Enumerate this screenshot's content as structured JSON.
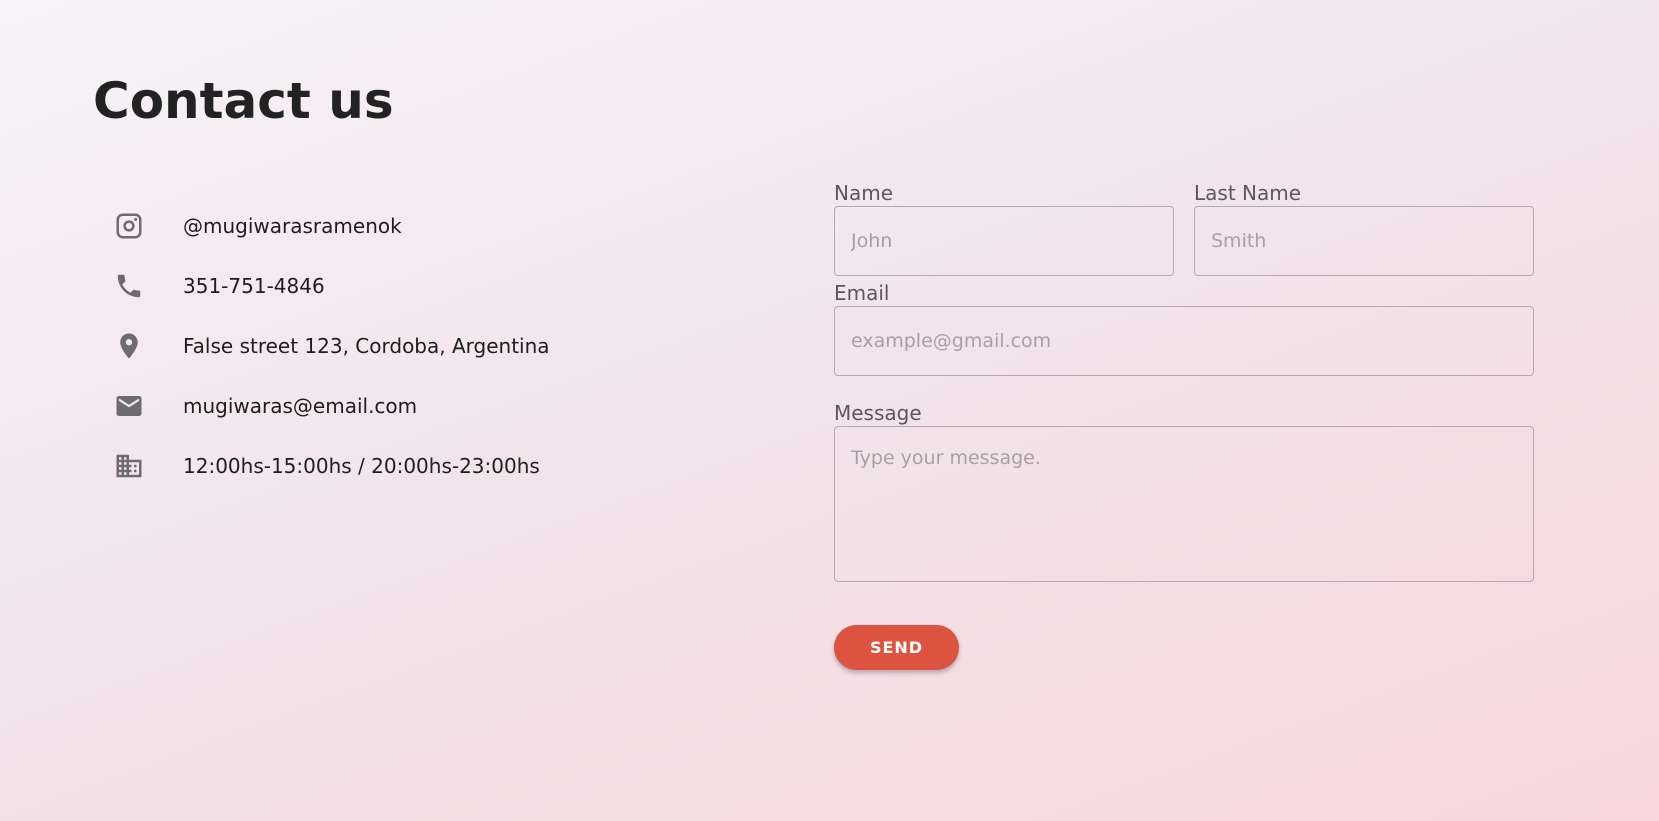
{
  "page": {
    "title": "Contact us"
  },
  "contact_info": [
    {
      "icon": "instagram-icon",
      "text": "@mugiwarasramenok"
    },
    {
      "icon": "phone-icon",
      "text": "351-751-4846"
    },
    {
      "icon": "location-pin-icon",
      "text": "False street 123, Cordoba, Argentina"
    },
    {
      "icon": "email-icon",
      "text": "mugiwaras@email.com"
    },
    {
      "icon": "building-icon",
      "text": "12:00hs-15:00hs / 20:00hs-23:00hs"
    }
  ],
  "form": {
    "name": {
      "label": "Name",
      "placeholder": "John",
      "value": ""
    },
    "last_name": {
      "label": "Last Name",
      "placeholder": "Smith",
      "value": ""
    },
    "email": {
      "label": "Email",
      "placeholder": "example@gmail.com",
      "value": ""
    },
    "message": {
      "label": "Message",
      "placeholder": "Type your message.",
      "value": ""
    },
    "send_label": "SEND"
  },
  "colors": {
    "accent": "#dc5440",
    "icon": "#6e6b6f",
    "text": "#222222"
  }
}
